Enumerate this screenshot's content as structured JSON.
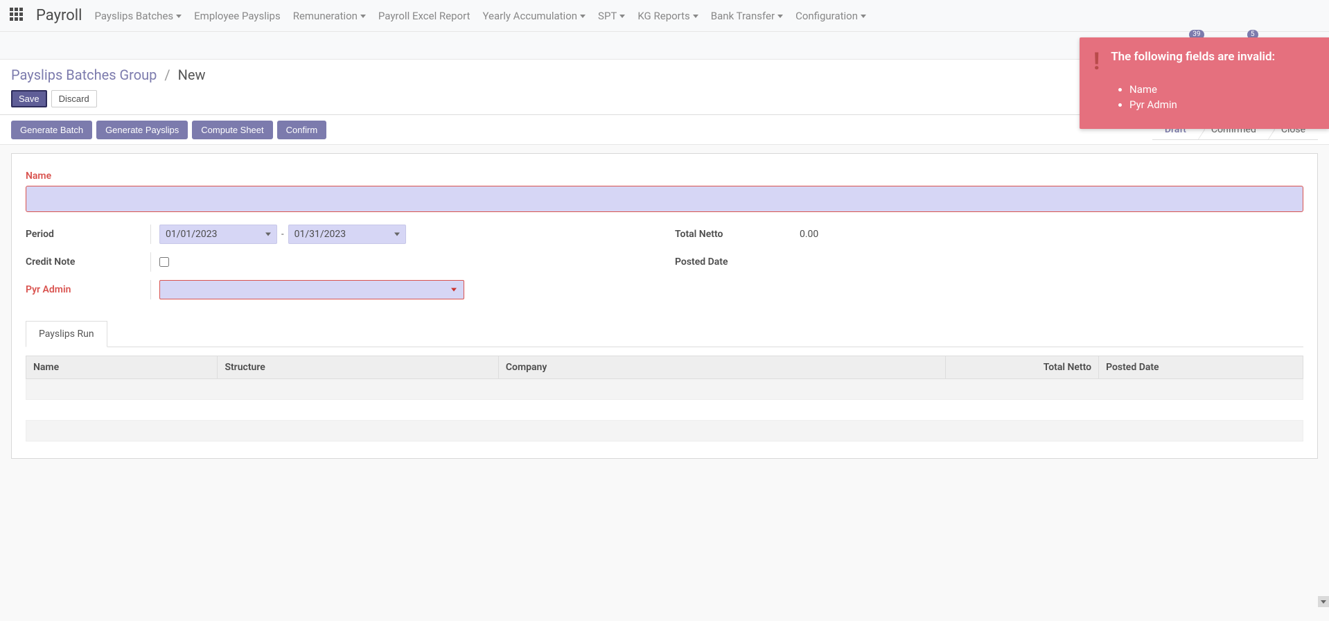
{
  "brand": "Payroll",
  "menu": [
    {
      "label": "Payslips Batches",
      "dropdown": true
    },
    {
      "label": "Employee Payslips",
      "dropdown": false
    },
    {
      "label": "Remuneration",
      "dropdown": true
    },
    {
      "label": "Payroll Excel Report",
      "dropdown": false
    },
    {
      "label": "Yearly Accumulation",
      "dropdown": true
    },
    {
      "label": "SPT",
      "dropdown": true
    },
    {
      "label": "KG Reports",
      "dropdown": true
    },
    {
      "label": "Bank Transfer",
      "dropdown": true
    },
    {
      "label": "Configuration",
      "dropdown": true
    }
  ],
  "systray": {
    "activities_badge": "39",
    "messages_badge": "5"
  },
  "notification": {
    "title": "The following fields are invalid:",
    "items": [
      "Name",
      "Pyr Admin"
    ]
  },
  "breadcrumb": {
    "parent": "Payslips Batches Group",
    "current": "New"
  },
  "buttons": {
    "save": "Save",
    "discard": "Discard"
  },
  "actions": [
    "Generate Batch",
    "Generate Payslips",
    "Compute Sheet",
    "Confirm"
  ],
  "status": {
    "steps": [
      "Draft",
      "Confirmed",
      "Close"
    ],
    "active": "Draft"
  },
  "form": {
    "name_label": "Name",
    "name_value": "",
    "period_label": "Period",
    "period_from": "01/01/2023",
    "period_sep": "-",
    "period_to": "01/31/2023",
    "credit_note_label": "Credit Note",
    "credit_note_checked": false,
    "pyr_admin_label": "Pyr Admin",
    "pyr_admin_value": "",
    "total_netto_label": "Total Netto",
    "total_netto_value": "0.00",
    "posted_date_label": "Posted Date",
    "posted_date_value": ""
  },
  "tabs": {
    "payslips_run": "Payslips Run"
  },
  "table": {
    "columns": [
      "Name",
      "Structure",
      "Company",
      "Total Netto",
      "Posted Date"
    ]
  }
}
